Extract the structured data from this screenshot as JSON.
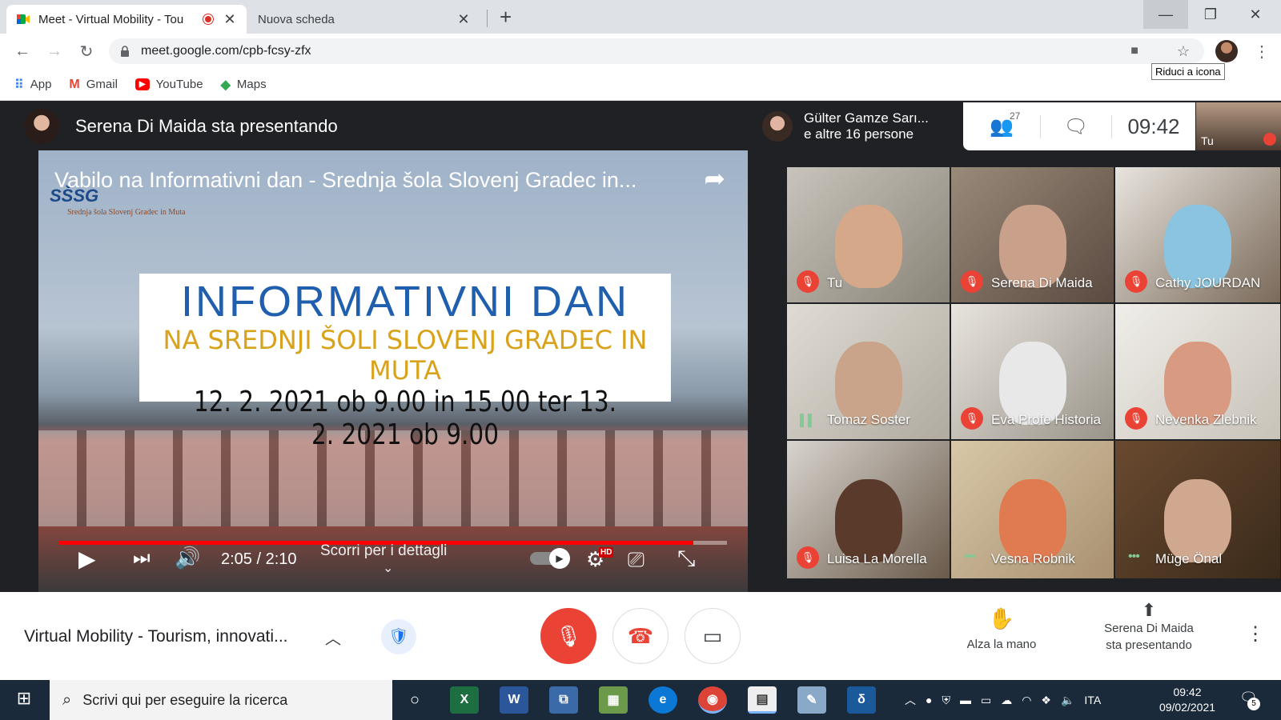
{
  "browser": {
    "tabs": [
      {
        "title": "Meet - Virtual Mobility - Tou",
        "recording": true
      },
      {
        "title": "Nuova scheda"
      }
    ],
    "url": "meet.google.com/cpb-fcsy-zfx",
    "tooltip": "Riduci a icona",
    "bookmarks": [
      "App",
      "Gmail",
      "YouTube",
      "Maps"
    ]
  },
  "meet": {
    "presenter_text": "Serena Di Maida sta presentando",
    "others_line1": "Gülter Gamze Sarı...",
    "others_line2": "e altre 16 persone",
    "participant_count": "27",
    "clock": "09:42",
    "self_label": "Tu",
    "video": {
      "title": "Vabilo na Informativni dan - Srednja šola Slovenj Gradec in...",
      "logo": "SŠSG",
      "logo_sub": "Srednja šola Slovenj Gradec in Muta",
      "poster_line1": "INFORMATIVNI DAN",
      "poster_line2": "NA SREDNJI ŠOLI SLOVENJ GRADEC IN MUTA",
      "poster_line3": "12. 2. 2021 ob 9.00 in 15.00 ter 13. 2. 2021 ob 9.00",
      "time": "2:05 / 2:10",
      "progress": 0.95,
      "scroll_hint": "Scorri per i dettagli",
      "hd_badge": "HD"
    },
    "participants": [
      {
        "name": "Tu",
        "state": "muted"
      },
      {
        "name": "Serena Di Maida",
        "state": "muted"
      },
      {
        "name": "Cathy JOURDAN",
        "state": "muted"
      },
      {
        "name": "Tomaz Soster",
        "state": "speaking"
      },
      {
        "name": "Eva Profe Historia",
        "state": "muted"
      },
      {
        "name": "Nevenka Zlebnik",
        "state": "muted"
      },
      {
        "name": "Luisa La Morella",
        "state": "muted"
      },
      {
        "name": "Vesna Robnik",
        "state": "dots"
      },
      {
        "name": "Müge Önal",
        "state": "dots"
      }
    ],
    "meeting_title": "Virtual Mobility - Tourism, innovati...",
    "raise_hand": "Alza la mano",
    "presenting_line1": "Serena Di Maida",
    "presenting_line2": "sta presentando"
  },
  "taskbar": {
    "search_placeholder": "Scrivi qui per eseguire la ricerca",
    "language": "ITA",
    "time": "09:42",
    "date": "09/02/2021",
    "notifications": "5"
  },
  "colors": {
    "meet_red": "#ea4335",
    "dark_bg": "#202124",
    "taskbar": "#1b2a3a",
    "yt_red": "#ff0000"
  }
}
